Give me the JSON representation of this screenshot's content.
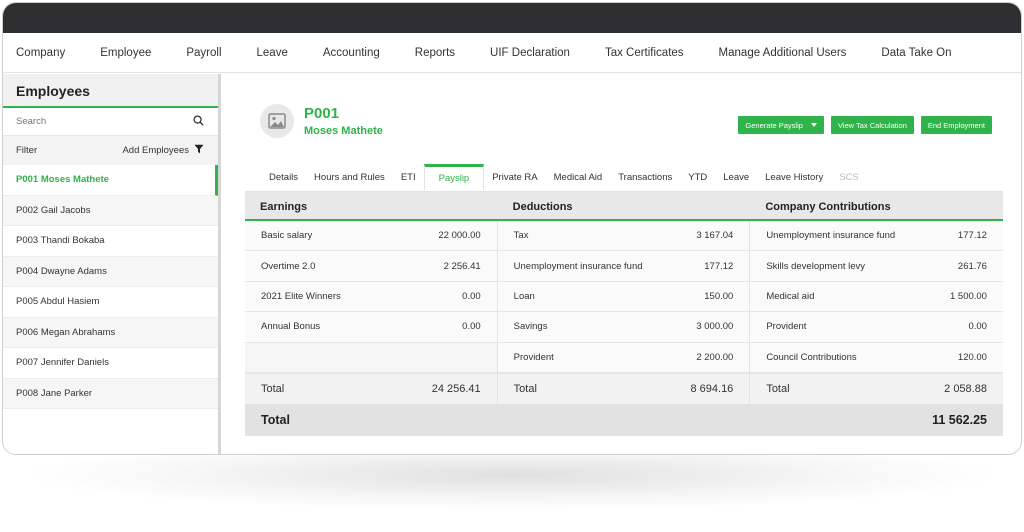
{
  "nav": [
    "Company",
    "Employee",
    "Payroll",
    "Leave",
    "Accounting",
    "Reports",
    "UIF Declaration",
    "Tax Certificates",
    "Manage Additional Users",
    "Data Take On"
  ],
  "sidebar": {
    "title": "Employees",
    "search_placeholder": "Search",
    "filter_label": "Filter",
    "add_label": "Add Employees",
    "employees": [
      "P001 Moses Mathete",
      "P002 Gail Jacobs",
      "P003 Thandi Bokaba",
      "P004 Dwayne Adams",
      "P005 Abdul Hasiem",
      "P006 Megan Abrahams",
      "P007 Jennifer Daniels",
      "P008 Jane Parker"
    ],
    "active_index": 0
  },
  "profile": {
    "code": "P001",
    "name": "Moses Mathete",
    "avatar_icon": "image-placeholder-icon"
  },
  "actions": {
    "generate": "Generate Payslip",
    "tax": "View Tax Calculation",
    "end": "End Employment"
  },
  "tabs": [
    "Details",
    "Hours and Rules",
    "ETI",
    "Payslip",
    "Private RA",
    "Medical Aid",
    "Transactions",
    "YTD",
    "Leave",
    "Leave History",
    "SCS"
  ],
  "active_tab": 3,
  "disabled_tab": 10,
  "payslip": {
    "headers": {
      "earnings": "Earnings",
      "deductions": "Deductions",
      "contributions": "Company Contributions"
    },
    "earnings": [
      {
        "label": "Basic salary",
        "value": "22 000.00"
      },
      {
        "label": "Overtime 2.0",
        "value": "2 256.41"
      },
      {
        "label": "2021 Elite Winners",
        "value": "0.00"
      },
      {
        "label": "Annual Bonus",
        "value": "0.00"
      }
    ],
    "deductions": [
      {
        "label": "Tax",
        "value": "3 167.04"
      },
      {
        "label": "Unemployment insurance fund",
        "value": "177.12"
      },
      {
        "label": "Loan",
        "value": "150.00"
      },
      {
        "label": "Savings",
        "value": "3 000.00"
      },
      {
        "label": "Provident",
        "value": "2 200.00"
      }
    ],
    "contributions": [
      {
        "label": "Unemployment insurance fund",
        "value": "177.12"
      },
      {
        "label": "Skills development levy",
        "value": "261.76"
      },
      {
        "label": "Medical aid",
        "value": "1 500.00"
      },
      {
        "label": "Provident",
        "value": "0.00"
      },
      {
        "label": "Council Contributions",
        "value": "120.00"
      }
    ],
    "totals": {
      "label": "Total",
      "earnings": "24 256.41",
      "deductions": "8 694.16",
      "contributions": "2 058.88"
    },
    "grand_total": {
      "label": "Total",
      "value": "11 562.25"
    }
  },
  "colors": {
    "accent": "#2fb34a",
    "titlebar": "#2f2f31"
  }
}
